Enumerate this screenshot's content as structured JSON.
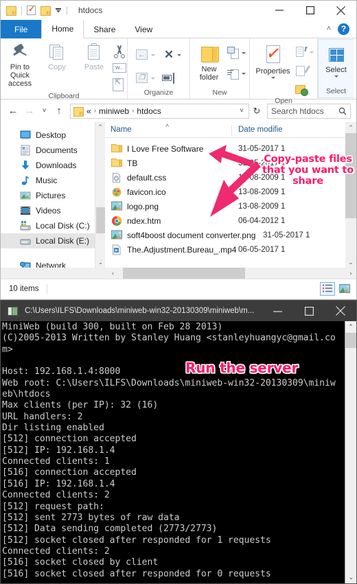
{
  "explorer": {
    "titlebar": {
      "title": "htdocs",
      "qat": [
        {
          "name": "folder-icon",
          "label": "Properties folder"
        },
        {
          "name": "properties-icon",
          "label": "Properties"
        },
        {
          "name": "new-folder-icon",
          "label": "New folder"
        },
        {
          "name": "customize-caret-icon",
          "label": "Customize Quick Access Toolbar"
        }
      ],
      "minimize": "—",
      "maximize": "□",
      "close": "✕"
    },
    "tabs": [
      {
        "label": "File",
        "state": "file"
      },
      {
        "label": "Home",
        "state": "active"
      },
      {
        "label": "Share",
        "state": "normal"
      },
      {
        "label": "View",
        "state": "normal"
      }
    ],
    "ribbon_right": {
      "collapse": "˄",
      "help": "?"
    },
    "ribbon": {
      "groups": [
        {
          "label": "Clipboard",
          "big": [
            {
              "label": "Pin to Quick\naccess",
              "icon": "pin-icon",
              "enabled": true
            },
            {
              "label": "Copy",
              "icon": "copy-icon",
              "enabled": false
            },
            {
              "label": "Paste",
              "icon": "paste-icon",
              "enabled": false
            }
          ],
          "small": [
            {
              "label": "Cut",
              "icon": "scissors-icon"
            },
            {
              "label": "Copy path",
              "icon": "copy-path-icon"
            },
            {
              "label": "Paste shortcut",
              "icon": "paste-shortcut-icon"
            }
          ]
        },
        {
          "label": "Organize",
          "small": [
            {
              "label": "Move to",
              "icon": "move-to-icon"
            },
            {
              "label": "Delete",
              "icon": "delete-icon"
            },
            {
              "label": "Copy to",
              "icon": "copy-to-icon"
            },
            {
              "label": "Rename",
              "icon": "rename-icon"
            }
          ]
        },
        {
          "label": "New",
          "big": [
            {
              "label": "New\nfolder",
              "icon": "new-folder-icon",
              "enabled": true
            }
          ],
          "small": [
            {
              "label": "New item",
              "icon": "new-item-icon"
            },
            {
              "label": "Easy access",
              "icon": "easy-access-icon"
            }
          ]
        },
        {
          "label": "Open",
          "big": [
            {
              "label": "Properties",
              "icon": "properties-icon",
              "enabled": true
            }
          ],
          "small": [
            {
              "label": "Open",
              "icon": "open-icon"
            },
            {
              "label": "Edit",
              "icon": "edit-icon"
            },
            {
              "label": "History",
              "icon": "history-icon"
            }
          ]
        },
        {
          "label": "Select",
          "big": [
            {
              "label": "Select",
              "icon": "select-icon",
              "enabled": true
            }
          ]
        }
      ]
    },
    "addressbar": {
      "back": "←",
      "forward": "→",
      "recent": "˅",
      "up": "↑",
      "breadcrumb": [
        "«",
        "miniweb",
        "htdocs"
      ],
      "dropdown_caret": "˅",
      "refresh": "↻",
      "search_placeholder": "Search htdocs",
      "search_icon": "search-icon"
    },
    "navpane": {
      "items": [
        {
          "label": "Desktop",
          "icon": "desktop-icon",
          "selected": false
        },
        {
          "label": "Documents",
          "icon": "documents-icon",
          "selected": false
        },
        {
          "label": "Downloads",
          "icon": "downloads-icon",
          "selected": false
        },
        {
          "label": "Music",
          "icon": "music-icon",
          "selected": false
        },
        {
          "label": "Pictures",
          "icon": "pictures-icon",
          "selected": false
        },
        {
          "label": "Videos",
          "icon": "videos-icon",
          "selected": false
        },
        {
          "label": "Local Disk (C:)",
          "icon": "drive-icon",
          "selected": false
        },
        {
          "label": "Local Disk (E:)",
          "icon": "drive-icon",
          "selected": true
        },
        {
          "label": "",
          "icon": "spacer",
          "selected": false
        },
        {
          "label": "Network",
          "icon": "network-icon",
          "selected": false
        }
      ]
    },
    "columns": [
      {
        "label": "Name",
        "sorted": true,
        "sort_caret": "˄"
      },
      {
        "label": "Date modifie",
        "sorted": false
      }
    ],
    "files": [
      {
        "name": "I Love Free Software",
        "icon": "folder-icon",
        "date": "31-05-2017 1"
      },
      {
        "name": "TB",
        "icon": "folder-icon",
        "date": "31-05-2017 1"
      },
      {
        "name": "default.css",
        "icon": "css-file-icon",
        "date": "13-08-2009 1"
      },
      {
        "name": "favicon.ico",
        "icon": "ico-file-icon",
        "date": "13-08-2009 1"
      },
      {
        "name": "logo.png",
        "icon": "image-file-icon",
        "date": "13-08-2009 1"
      },
      {
        "name": "ndex.htm",
        "icon": "chrome-file-icon",
        "date": "06-04-2012 1"
      },
      {
        "name": "soft4boost document converter.png",
        "icon": "image-file-icon",
        "date": "31-05-2017 1"
      },
      {
        "name": "The.Adjustment.Bureau_.mp4",
        "icon": "video-file-icon",
        "date": "06-05-2017 1"
      }
    ],
    "statusbar": {
      "item_count": "10 items",
      "view_details_icon": "details-view-icon",
      "view_thumbnails_icon": "large-icons-view-icon"
    }
  },
  "console": {
    "title": "C:\\Users\\ILFS\\Downloads\\miniweb-win32-20130309\\miniweb\\m...",
    "icon": "console-icon",
    "minimize": "—",
    "maximize": "□",
    "close": "✕",
    "output": "MiniWeb (build 300, built on Feb 28 2013)\n(C)2005-2013 Written by Stanley Huang <stanleyhuangyc@gmail.co\nm>\n\nHost: 192.168.1.4:8000\nWeb root: C:\\Users\\ILFS\\Downloads\\miniweb-win32-20130309\\miniw\neb\\htdocs\nMax clients (per IP): 32 (16)\nURL handlers: 2\nDir listing enabled\n[512] connection accepted\n[512] IP: 192.168.1.4\nConnected clients: 1\n[516] connection accepted\n[516] IP: 192.168.1.4\nConnected clients: 2\n[512] request path:\n[512] sent 2773 bytes of raw data\n[512] Data sending completed (2773/2773)\n[512] socket closed after responded for 1 requests\nConnected clients: 2\n[516] socket closed by client\n[516] socket closed after responded for 0 requests"
  },
  "annotations": [
    {
      "name": "copy-paste-annotation",
      "text": "Copy-paste files that you want to share",
      "color": "#ff1a6b"
    },
    {
      "name": "run-server-annotation",
      "text": "Run the server",
      "color": "#ff1a6b"
    }
  ],
  "colors": {
    "accent": "#1a78c8",
    "annotation": "#ff1a6b",
    "console_bg": "#000000",
    "console_text": "#cccccc",
    "folder": "#fcd361"
  }
}
